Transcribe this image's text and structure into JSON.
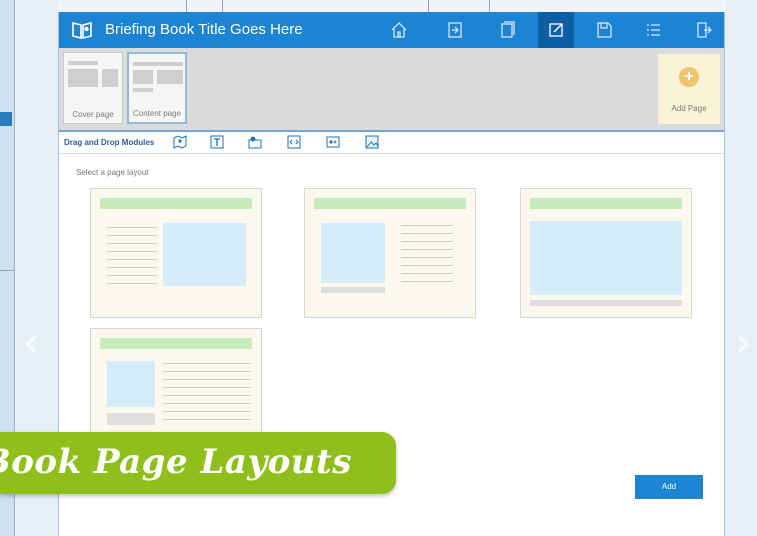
{
  "header": {
    "title": "Briefing Book Title Goes Here",
    "color": "#1d83d3",
    "buttons": [
      {
        "name": "home-icon"
      },
      {
        "name": "export-icon"
      },
      {
        "name": "pages-icon"
      },
      {
        "name": "edit-icon",
        "active": true
      },
      {
        "name": "save-icon"
      },
      {
        "name": "list-icon"
      },
      {
        "name": "exit-icon"
      }
    ]
  },
  "page_strip": {
    "pages": [
      {
        "label": "Cover page"
      },
      {
        "label": "Content page",
        "selected": true
      }
    ],
    "add_page_label": "Add Page",
    "add_symbol": "+"
  },
  "modules": {
    "label": "Drag and Drop Modules",
    "icons": [
      "map-icon",
      "text-module-icon",
      "location-icon",
      "embed-icon",
      "video-icon",
      "image-icon"
    ]
  },
  "layouts": {
    "prompt": "Select a page layout",
    "items": [
      {
        "name": "text-left-image-right"
      },
      {
        "name": "image-left-text-right"
      },
      {
        "name": "full-width-image"
      },
      {
        "name": "image-left-caption-text-right"
      }
    ]
  },
  "add_button_label": "Add",
  "banner": {
    "text": "Book Page Layouts",
    "color": "#8ebf1a"
  },
  "nav": {
    "prev": "‹",
    "next": "›"
  }
}
